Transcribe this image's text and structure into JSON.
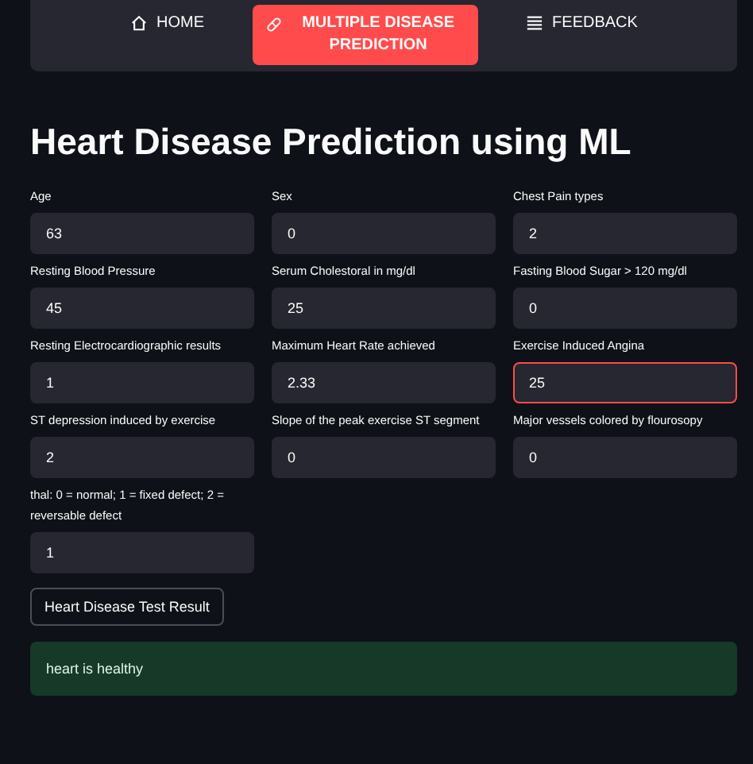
{
  "nav": [
    {
      "label": "HOME",
      "selected": false
    },
    {
      "label": "MULTIPLE DISEASE PREDICTION",
      "selected": true
    },
    {
      "label": "FEEDBACK",
      "selected": false
    }
  ],
  "title": "Heart Disease Prediction using ML",
  "fields": [
    {
      "label": "Age",
      "value": "63",
      "focused": false
    },
    {
      "label": "Sex",
      "value": "0",
      "focused": false
    },
    {
      "label": "Chest Pain types",
      "value": "2",
      "focused": false
    },
    {
      "label": "Resting Blood Pressure",
      "value": "45",
      "focused": false
    },
    {
      "label": "Serum Cholestoral in mg/dl",
      "value": "25",
      "focused": false
    },
    {
      "label": "Fasting Blood Sugar > 120 mg/dl",
      "value": "0",
      "focused": false
    },
    {
      "label": "Resting Electrocardiographic results",
      "value": "1",
      "focused": false
    },
    {
      "label": "Maximum Heart Rate achieved",
      "value": "2.33",
      "focused": false
    },
    {
      "label": "Exercise Induced Angina",
      "value": "25",
      "focused": true
    },
    {
      "label": "ST depression induced by exercise",
      "value": "2",
      "focused": false
    },
    {
      "label": "Slope of the peak exercise ST segment",
      "value": "0",
      "focused": false
    },
    {
      "label": "Major vessels colored by flourosopy",
      "value": "0",
      "focused": false
    },
    {
      "label": "thal: 0 = normal; 1 = fixed defect; 2 = reversable defect",
      "value": "1",
      "focused": false
    }
  ],
  "button": "Heart Disease Test Result",
  "result": "heart is healthy"
}
